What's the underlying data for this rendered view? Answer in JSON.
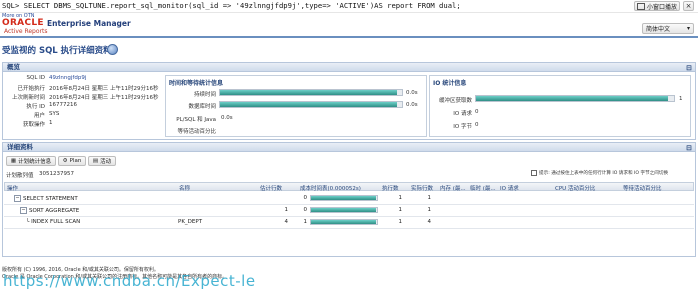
{
  "console": {
    "sql": "SQL> SELECT DBMS_SQLTUNE.report_sql_monitor(sql_id => '49zlnngjfdp9j',type=> 'ACTIVE')AS report FROM dual;",
    "small_window_label": "小窗口播放",
    "close_label": "×"
  },
  "header": {
    "more_on": "More on OTN",
    "brand": "ORACLE",
    "product": "Enterprise Manager",
    "subtitle": "Active Reports",
    "language": "简体中文",
    "page_title": "受监视的 SQL 执行详细资料"
  },
  "overview": {
    "title": "概览",
    "left_fields": [
      {
        "label": "SQL ID",
        "value": "49zlnngjfdp9j"
      },
      {
        "label": "已开始执行",
        "value": "2016年8月24日 星期三 上午11时29分16秒"
      },
      {
        "label": "上次刷新时间",
        "value": "2016年8月24日 星期三 上午11时29分16秒"
      },
      {
        "label": "执行 ID",
        "value": "16777216"
      },
      {
        "label": "用户",
        "value": "SYS"
      },
      {
        "label": "获取操作",
        "value": "1"
      }
    ],
    "time_panel": {
      "title": "时间和等待统计信息",
      "rows": [
        {
          "label": "持续时间",
          "value": "0.0s",
          "fill": 0.97
        },
        {
          "label": "数据库时间",
          "value": "0.0s",
          "fill": 0.97
        }
      ],
      "plsql_label": "PL/SQL 和 Java",
      "plsql_value": "0.0s",
      "wait_label": "等待活动百分比"
    },
    "io_panel": {
      "title": "IO 统计信息",
      "rows": [
        {
          "label": "缓冲区获取数",
          "value": "1",
          "fill": 0.97
        },
        {
          "label": "IO 请求",
          "value": "0"
        },
        {
          "label": "IO 字节",
          "value": "0"
        }
      ]
    }
  },
  "detail": {
    "title": "详细资料",
    "tabs": [
      "计划统计信息",
      "Plan",
      "活动"
    ],
    "plan_hash_label": "计划散列值",
    "plan_hash_value": "3051237957",
    "hint": "提示: 通过按住上表中的任何行计算 IO 请求和 IO 字节之间切换",
    "columns": [
      "操作",
      "名称",
      "估计行数",
      "成本",
      "时间表(0.000052s)",
      "执行数",
      "实际行数",
      "内存 (最...",
      "临时 (最...",
      "IO 请求",
      "CPU 活动百分比",
      "等待活动百分比"
    ],
    "rows": [
      {
        "op": "SELECT STATEMENT",
        "level": 0,
        "name": "",
        "est_rows": "",
        "cost": "0",
        "timeline": 0.99,
        "execs": "1",
        "act_rows": "1"
      },
      {
        "op": "SORT AGGREGATE",
        "level": 1,
        "name": "",
        "est_rows": "1",
        "cost": "0",
        "timeline": 0.99,
        "execs": "1",
        "act_rows": "1"
      },
      {
        "op": "INDEX FULL SCAN",
        "level": 2,
        "name": "PK_DEPT",
        "est_rows": "4",
        "cost": "1",
        "timeline": 0.99,
        "execs": "1",
        "act_rows": "4"
      }
    ]
  },
  "footer": {
    "copyright": "版权所有 (C) 1996, 2016, Oracle 和/或其关联公司。保留所有权利。",
    "trademark": "Oracle 是 Oracle Corporation 和/或其关联公司的注册商标。其他名称可能是其各自所有者的商标。",
    "watermark": "https://www.cndba.cn/Expect-le"
  },
  "colors": {
    "accent": "#27467a",
    "brand": "#d42a1a",
    "bar": "#2f8f86",
    "watermark": "#29a8cc"
  }
}
